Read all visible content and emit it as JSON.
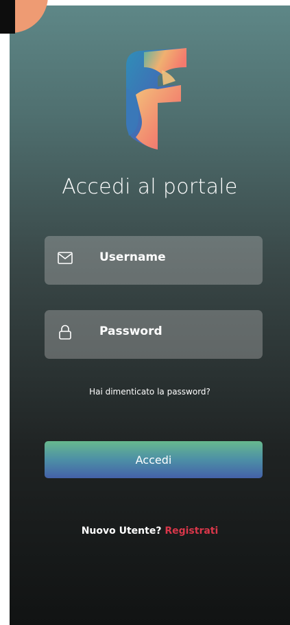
{
  "title": "Accedi al portale",
  "username": {
    "placeholder": "Username",
    "icon": "envelope-icon"
  },
  "password": {
    "placeholder": "Password",
    "icon": "lock-icon"
  },
  "forgot_password_link": "Hai dimenticato la password?",
  "login_button": "Accedi",
  "signup": {
    "prompt": "Nuovo Utente?",
    "link": "Registrati"
  },
  "colors": {
    "background_top": "#5e8787",
    "background_bottom": "#111313",
    "link": "#d9374a",
    "button_top": "#67b98e",
    "button_bottom": "#4461a8",
    "badge": "#ee9b73"
  }
}
